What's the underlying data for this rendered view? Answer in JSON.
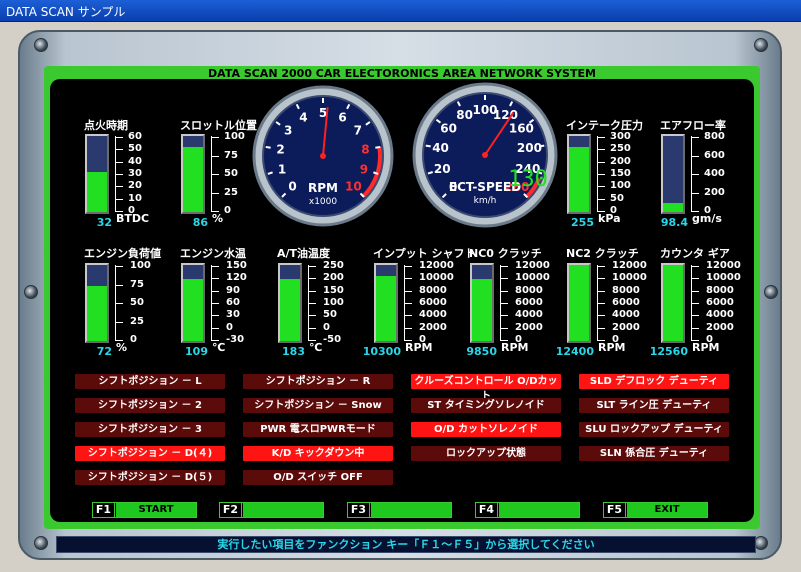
{
  "window": {
    "title": "DATA SCAN サンプル"
  },
  "header": {
    "title": "DATA SCAN 2000  CAR ELECTORONICS  AREA  NETWORK  SYSTEM"
  },
  "colors": {
    "green": "#21e021",
    "value_cyan": "#29d7e8",
    "active_red": "#ff1414",
    "inactive_red": "#5c0b0b",
    "gauge_face": "#0c1b5a"
  },
  "meters_top": [
    {
      "label": "点火時期",
      "value": "32",
      "unit": "BTDC",
      "level": 0.53,
      "ticks": [
        "60",
        "50",
        "40",
        "30",
        "20",
        "10",
        "0"
      ]
    },
    {
      "label": "スロットル位置",
      "value": "86",
      "unit": "%",
      "level": 0.86,
      "ticks": [
        "100",
        "75",
        "50",
        "25",
        "0"
      ]
    },
    {
      "label": "インテーク圧力",
      "value": "255",
      "unit": "kPa",
      "level": 0.85,
      "ticks": [
        "300",
        "250",
        "200",
        "150",
        "100",
        "50",
        "0"
      ]
    },
    {
      "label": "エアフロー率",
      "value": "98.4",
      "unit": "gm/s",
      "level": 0.12,
      "ticks": [
        "800",
        "600",
        "400",
        "200",
        "0"
      ]
    }
  ],
  "meters_bottom": [
    {
      "label": "エンジン負荷値",
      "value": "72",
      "unit": "%",
      "level": 0.72,
      "ticks": [
        "100",
        "75",
        "50",
        "25",
        "0"
      ]
    },
    {
      "label": "エンジン水温",
      "value": "109",
      "unit": "℃",
      "level": 0.81,
      "ticks": [
        "150",
        "120",
        "90",
        "60",
        "30",
        "0",
        "-30"
      ]
    },
    {
      "label": "A/T油温度",
      "value": "183",
      "unit": "℃",
      "level": 0.81,
      "ticks": [
        "250",
        "200",
        "150",
        "100",
        "50",
        "0",
        "-50"
      ]
    },
    {
      "label": "インプット シャフト",
      "value": "10300",
      "unit": "RPM",
      "level": 0.86,
      "ticks": [
        "12000",
        "10000",
        "8000",
        "6000",
        "4000",
        "2000",
        "0"
      ]
    },
    {
      "label": "NC0 クラッチ",
      "value": "9850",
      "unit": "RPM",
      "level": 0.82,
      "ticks": [
        "12000",
        "10000",
        "8000",
        "6000",
        "4000",
        "2000",
        "0"
      ]
    },
    {
      "label": "NC2 クラッチ",
      "value": "12400",
      "unit": "RPM",
      "level": 1.0,
      "ticks": [
        "12000",
        "10000",
        "8000",
        "6000",
        "4000",
        "2000",
        "0"
      ]
    },
    {
      "label": "カウンタ ギア",
      "value": "12560",
      "unit": "RPM",
      "level": 1.0,
      "ticks": [
        "12000",
        "10000",
        "8000",
        "6000",
        "4000",
        "2000",
        "0"
      ]
    }
  ],
  "gauges": {
    "rpm": {
      "label": "RPM",
      "sublabel": "x1000",
      "ticks": [
        "0",
        "1",
        "2",
        "3",
        "4",
        "5",
        "6",
        "7",
        "8",
        "9",
        "10"
      ],
      "value": 5.2
    },
    "speed": {
      "label": "ECT-SPEED",
      "sublabel": "km/h",
      "ticks": [
        "0",
        "20",
        "40",
        "60",
        "80",
        "100",
        "120",
        "160",
        "200",
        "240",
        "280"
      ],
      "value": 130,
      "digital": "130"
    }
  },
  "status_buttons": [
    [
      {
        "label": "シフトポジション － L",
        "active": false
      },
      {
        "label": "シフトポジション － 2",
        "active": false
      },
      {
        "label": "シフトポジション － 3",
        "active": false
      },
      {
        "label": "シフトポジション － D(４)",
        "active": true
      },
      {
        "label": "シフトポジション － D(５)",
        "active": false
      }
    ],
    [
      {
        "label": "シフトポジション － R",
        "active": false
      },
      {
        "label": "シフトポジション － Snow",
        "active": false
      },
      {
        "label": "PWR 電スロPWRモード",
        "active": false
      },
      {
        "label": "K/D キックダウン中",
        "active": true
      },
      {
        "label": "O/D スイッチ OFF",
        "active": false
      }
    ],
    [
      {
        "label": "クルーズコントロール O/Dカット",
        "active": true
      },
      {
        "label": "ST タイミングソレノイド",
        "active": false
      },
      {
        "label": "O/D カットソレノイド",
        "active": true
      },
      {
        "label": "ロックアップ状態",
        "active": false
      }
    ],
    [
      {
        "label": "SLD デフロック デューティ",
        "active": true
      },
      {
        "label": "SLT ライン圧 デューティ",
        "active": false
      },
      {
        "label": "SLU ロックアップ デューティ",
        "active": false
      },
      {
        "label": "SLN 係合圧 デューティ",
        "active": false
      }
    ]
  ],
  "function_keys": [
    {
      "key": "F1",
      "label": "START"
    },
    {
      "key": "F2",
      "label": ""
    },
    {
      "key": "F3",
      "label": ""
    },
    {
      "key": "F4",
      "label": ""
    },
    {
      "key": "F5",
      "label": "EXIT"
    }
  ],
  "status_bar": {
    "message": "実行したい項目をファンクション キー「Ｆ１～Ｆ５」から選択してください"
  }
}
